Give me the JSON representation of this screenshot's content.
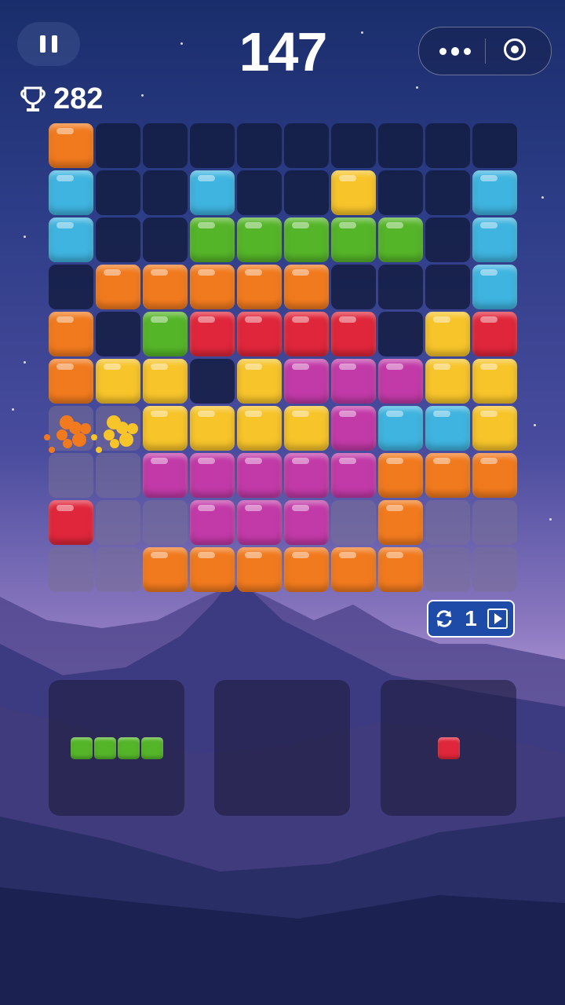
{
  "score": "147",
  "best_score": "282",
  "refresh_count": "1",
  "colors": {
    "orange": "#f27a1e",
    "blue": "#3fb4e0",
    "yellow": "#f7c42a",
    "green": "#55b529",
    "red": "#e0263a",
    "purple": "#c23aa8"
  },
  "board": [
    [
      "orange",
      "-",
      "-",
      "-",
      "-",
      "-",
      "-",
      "-",
      "-",
      "-"
    ],
    [
      "blue",
      "-",
      "-",
      "blue",
      "-",
      "-",
      "yellow",
      "-",
      "-",
      "blue"
    ],
    [
      "blue",
      "-",
      "-",
      "green",
      "green",
      "green",
      "green",
      "green",
      "-",
      "blue"
    ],
    [
      "-",
      "orange",
      "orange",
      "orange",
      "orange",
      "orange",
      "-",
      "-",
      "-",
      "blue"
    ],
    [
      "orange",
      "-",
      "green",
      "red",
      "red",
      "red",
      "red",
      "-",
      "yellow",
      "red"
    ],
    [
      "orange",
      "yellow",
      "yellow",
      "-",
      "yellow",
      "purple",
      "purple",
      "purple",
      "yellow",
      "yellow"
    ],
    [
      "burst-orange",
      "burst-yellow",
      "yellow",
      "yellow",
      "yellow",
      "yellow",
      "purple",
      "blue",
      "blue",
      "yellow"
    ],
    [
      "-",
      "-",
      "purple",
      "purple",
      "purple",
      "purple",
      "purple",
      "orange",
      "orange",
      "orange"
    ],
    [
      "red",
      "-",
      "-",
      "purple",
      "purple",
      "purple",
      "-",
      "orange",
      "-",
      "-"
    ],
    [
      "-",
      "-",
      "orange",
      "orange",
      "orange",
      "orange",
      "orange",
      "orange",
      "-",
      "-"
    ]
  ],
  "pieces": [
    {
      "color": "green",
      "cells": [
        [
          0,
          0
        ],
        [
          0,
          1
        ],
        [
          0,
          2
        ],
        [
          0,
          3
        ]
      ]
    },
    {
      "color": "",
      "cells": []
    },
    {
      "color": "red",
      "cells": [
        [
          0,
          0
        ]
      ]
    }
  ],
  "icons": {
    "pause": "pause-icon",
    "more": "more-dots-icon",
    "close": "target-icon",
    "trophy": "trophy-icon",
    "refresh": "refresh-icon",
    "video": "play-video-icon"
  }
}
